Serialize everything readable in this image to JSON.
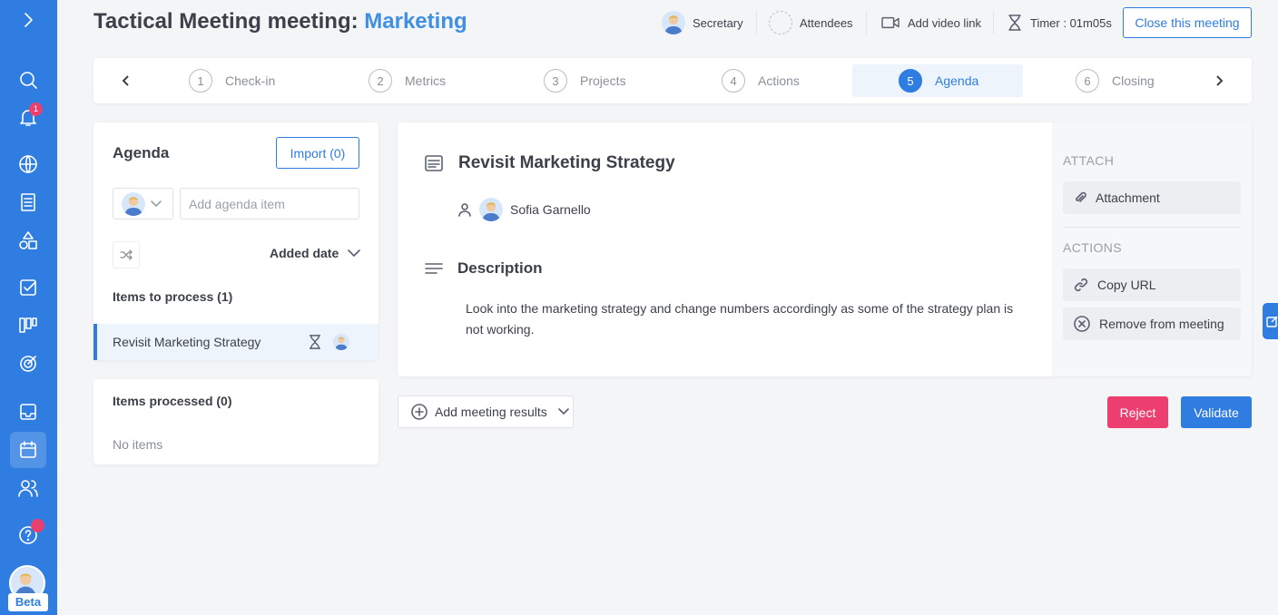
{
  "header": {
    "title_prefix": "Tactical Meeting meeting:",
    "title_topic": "Marketing",
    "secretary_label": "Secretary",
    "attendees_label": "Attendees",
    "video_label": "Add video link",
    "timer_label": "Timer : 01m05s",
    "close_label": "Close this meeting"
  },
  "sidebar": {
    "notification_count": "1",
    "beta_label": "Beta",
    "items": [
      "search-icon",
      "bell-icon",
      "globe-icon",
      "document-icon",
      "shapes-icon",
      "checkbox-icon",
      "kanban-icon",
      "target-icon",
      "inbox-icon",
      "calendar-icon",
      "users-icon",
      "help-icon"
    ]
  },
  "stepper": {
    "steps": [
      {
        "num": "1",
        "label": "Check-in"
      },
      {
        "num": "2",
        "label": "Metrics"
      },
      {
        "num": "3",
        "label": "Projects"
      },
      {
        "num": "4",
        "label": "Actions"
      },
      {
        "num": "5",
        "label": "Agenda"
      },
      {
        "num": "6",
        "label": "Closing"
      }
    ],
    "active_step": 5
  },
  "agenda": {
    "title": "Agenda",
    "import_label": "Import (0)",
    "add_placeholder": "Add agenda item",
    "sort_label": "Added date",
    "to_process_label": "Items to process (1)",
    "items": [
      {
        "label": "Revisit Marketing Strategy"
      }
    ],
    "processed_label": "Items processed (0)",
    "no_items_label": "No items"
  },
  "detail": {
    "title": "Revisit Marketing Strategy",
    "owner": "Sofia Garnello",
    "description_title": "Description",
    "description": "Look into the marketing strategy and change numbers accordingly as some of the strategy plan is not working.",
    "attach_label": "ATTACH",
    "attachment_label": "Attachment",
    "actions_label": "ACTIONS",
    "copy_url_label": "Copy URL",
    "remove_label": "Remove from meeting"
  },
  "footer": {
    "results_label": "Add meeting results",
    "reject_label": "Reject",
    "validate_label": "Validate"
  },
  "colors": {
    "brand": "#2f7de1",
    "reject": "#ec3f70",
    "badge": "#e8416f"
  }
}
